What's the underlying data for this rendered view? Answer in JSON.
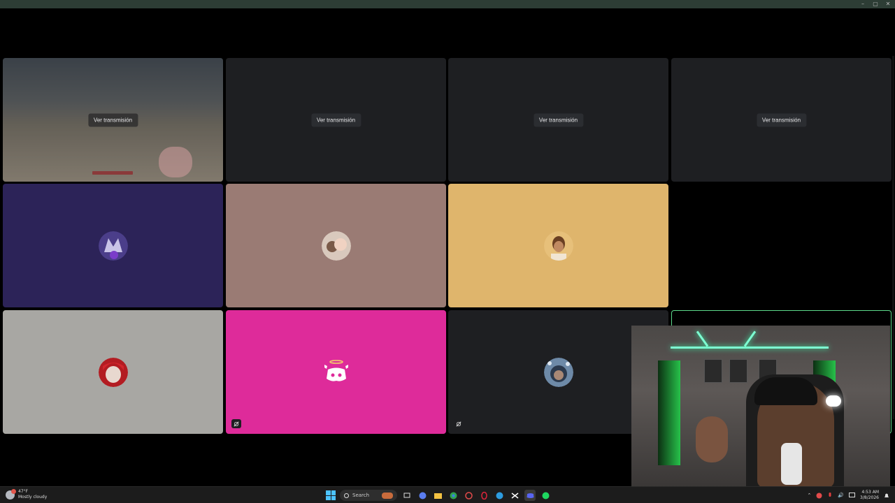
{
  "window": {
    "minimize": "–",
    "maximize": "▢",
    "close": "✕"
  },
  "tiles": {
    "watch_label": "Ver transmisión"
  },
  "colors": {
    "tile_purple": "#2c2358",
    "tile_mauve": "#9a7b74",
    "tile_sand": "#dfb56c",
    "tile_grey": "#a8a7a3",
    "tile_pink": "#de2b9a",
    "tile_dark": "#1e1f22",
    "active_border": "#5cd98b"
  },
  "taskbar": {
    "weather_temp": "47°F",
    "weather_desc": "Mostly cloudy",
    "search_placeholder": "Search",
    "time": "4:53 AM",
    "date": "3/8/2026"
  }
}
